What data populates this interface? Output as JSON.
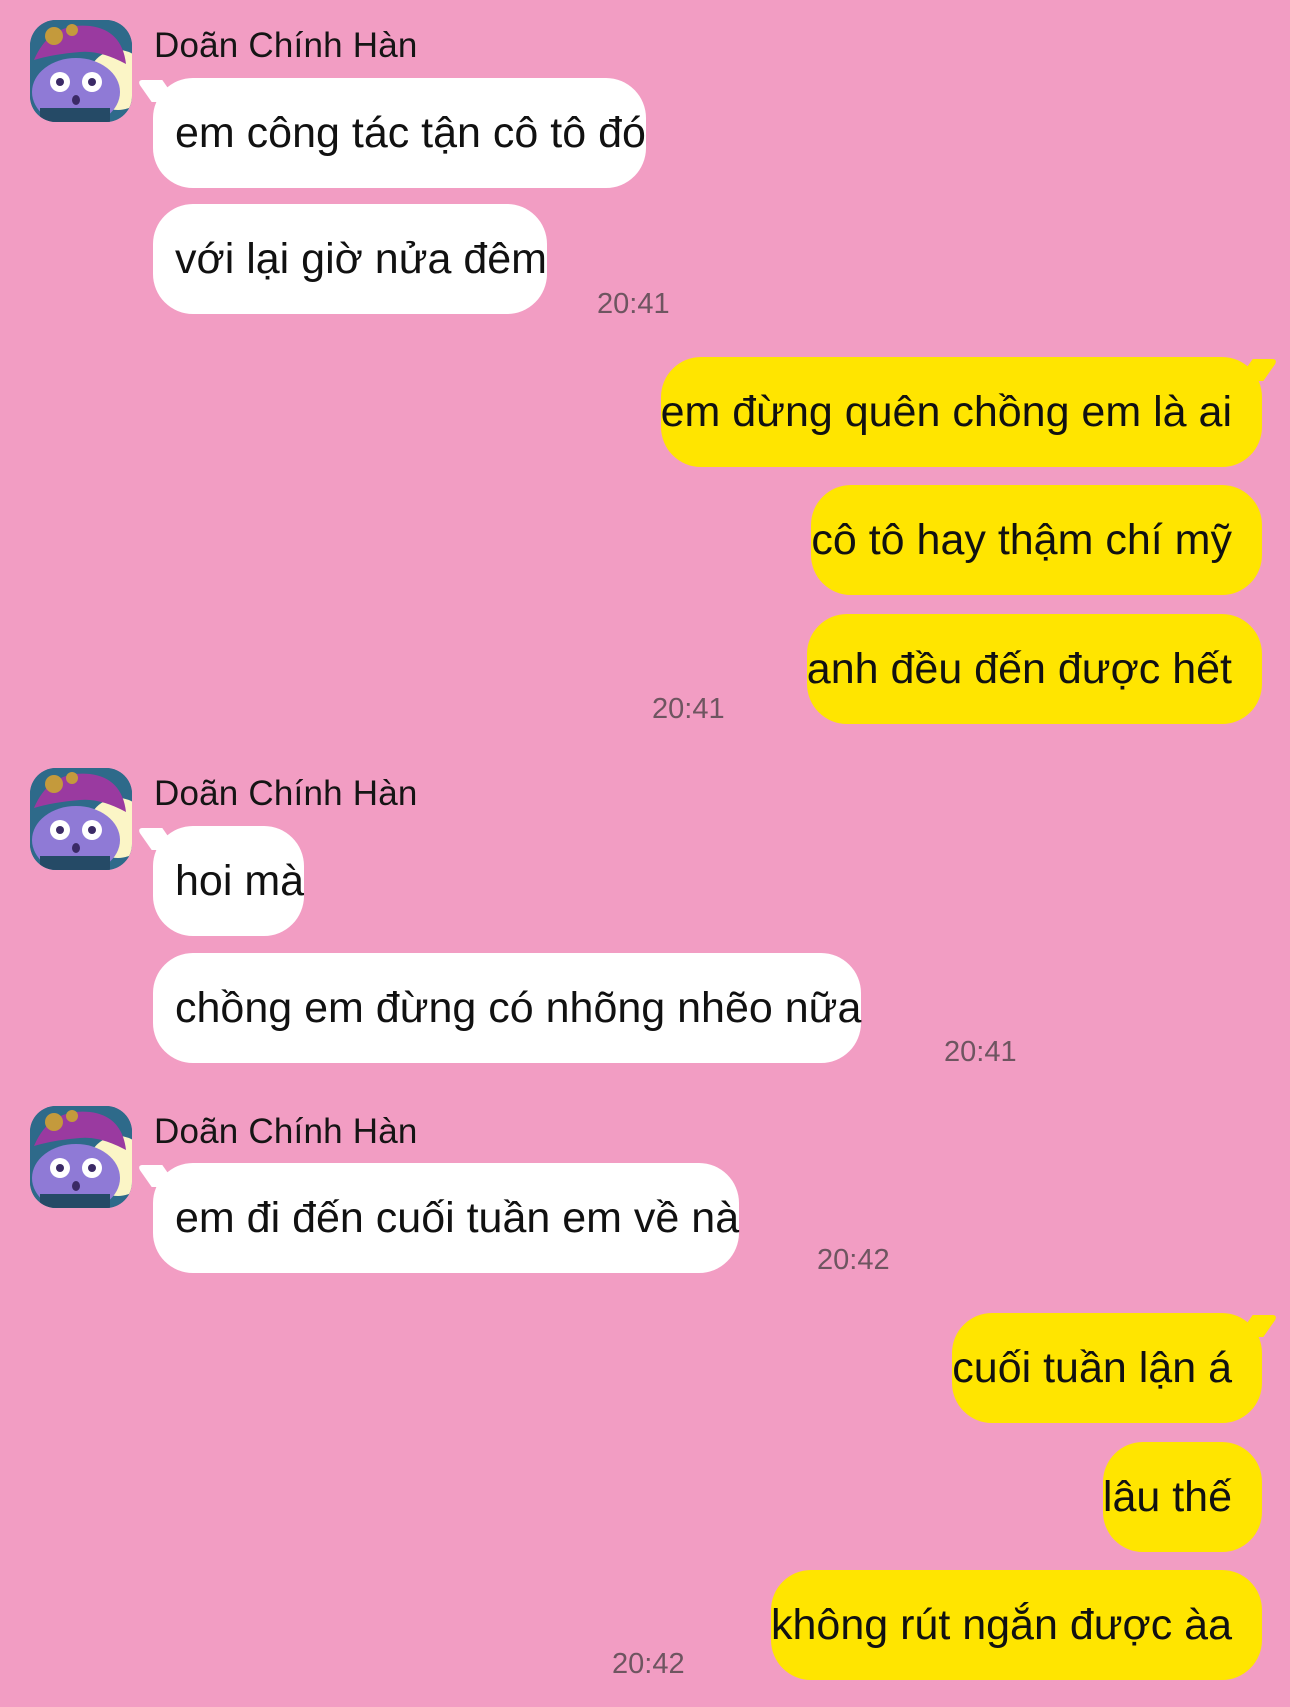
{
  "colors": {
    "background": "#f29dc3",
    "incoming_bubble": "#ffffff",
    "outgoing_bubble": "#ffe500",
    "timestamp": "#6e5560"
  },
  "groups": [
    {
      "sender": "Doãn Chính Hàn",
      "avatar_icon": "sticker-avatar-icon",
      "messages": [
        "em công tác tận cô tô đó",
        "với lại giờ nửa đêm"
      ],
      "time": "20:41"
    },
    {
      "direction": "outgoing",
      "messages": [
        "em đừng quên chồng em là ai",
        "cô tô hay thậm chí mỹ",
        "anh đều đến được hết"
      ],
      "time": "20:41"
    },
    {
      "sender": "Doãn Chính Hàn",
      "avatar_icon": "sticker-avatar-icon",
      "messages": [
        "hoi mà",
        "chồng em đừng có nhõng nhẽo nữa"
      ],
      "time": "20:41"
    },
    {
      "sender": "Doãn Chính Hàn",
      "avatar_icon": "sticker-avatar-icon",
      "messages": [
        "em đi đến cuối tuần em về nà"
      ],
      "time": "20:42"
    },
    {
      "direction": "outgoing",
      "messages": [
        "cuối tuần lận á",
        "lâu thế",
        "không rút ngắn được àa"
      ],
      "time": "20:42"
    }
  ]
}
